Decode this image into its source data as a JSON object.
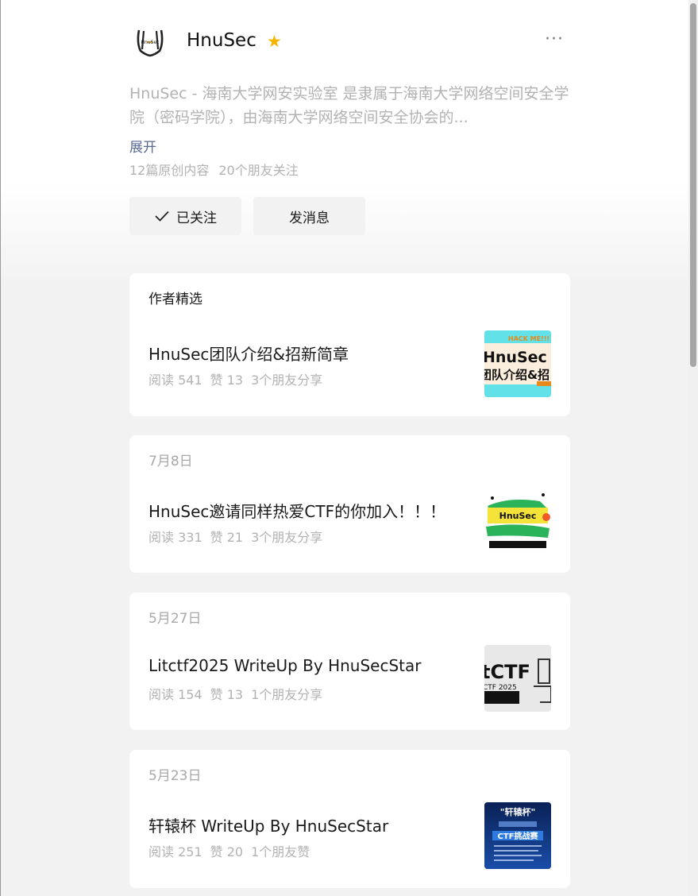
{
  "account": {
    "name": "HnuSec",
    "logo_text": "HnuSec",
    "description": "HnuSec - 海南大学网安实验室 是隶属于海南大学网络空间安全学院（密码学院），由海南大学网络空间安全协会的...",
    "expand_label": "展开",
    "original_count": "12篇原创内容",
    "friends_following": "20个朋友关注"
  },
  "actions": {
    "follow_label": "已关注",
    "message_label": "发消息"
  },
  "featured": {
    "label": "作者精选",
    "article": {
      "title": "HnuSec团队介绍&招新简章",
      "reads": "阅读 541",
      "likes": "赞 13",
      "social": "3个朋友分享",
      "thumb_text_top": "HACK ME!!!",
      "thumb_text_main": "HnuSec",
      "thumb_text_sub": "团队介绍&招"
    }
  },
  "articles": [
    {
      "date": "7月8日",
      "title": "HnuSec邀请同样热爱CTF的你加入！！！",
      "reads": "阅读 331",
      "likes": "赞 21",
      "social": "3个朋友分享",
      "thumb_text_main": "HnuSec"
    },
    {
      "date": "5月27日",
      "title": "Litctf2025 WriteUp By HnuSecStar",
      "reads": "阅读 154",
      "likes": "赞 13",
      "social": "1个朋友分享",
      "thumb_text_main": "tCTF",
      "thumb_text_sub": "CTF 2025"
    },
    {
      "date": "5月23日",
      "title": "轩辕杯 WriteUp By HnuSecStar",
      "reads": "阅读 251",
      "likes": "赞 20",
      "social": "1个朋友赞",
      "thumb_text_main": "\"轩辕杯\"",
      "thumb_text_sub": "CTF挑战赛"
    }
  ],
  "colors": {
    "star": "#f7b500",
    "link": "#576b95",
    "muted": "#b2b2b2",
    "button_bg": "#f2f2f2"
  },
  "icons": [
    "star-icon",
    "more-icon",
    "check-icon"
  ]
}
